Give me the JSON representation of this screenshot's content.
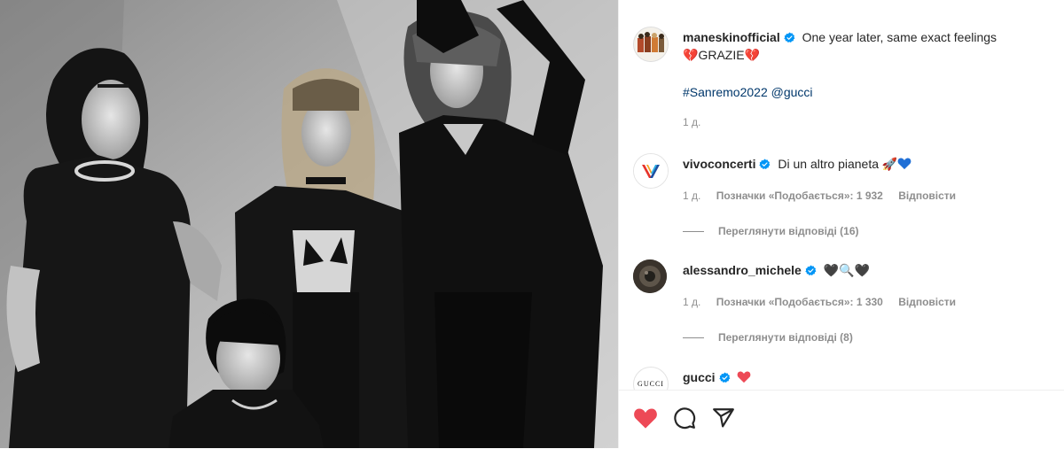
{
  "post": {
    "author": "maneskinofficial",
    "caption_line1": "One year later, same exact feelings",
    "caption_line2_word": "GRAZIE",
    "caption_line2_emoji_left": "💔",
    "caption_line2_emoji_right": "💔",
    "hashtag": "#Sanremo2022",
    "mention": "@gucci",
    "time": "1 д."
  },
  "comments": [
    {
      "username": "vivoconcerti",
      "text": "Di un altro pianeta",
      "emoji": "🚀",
      "time": "1 д.",
      "likes": "Позначки «Подобається»: 1 932",
      "reply_label": "Відповісти",
      "view_replies": "Переглянути відповіді (16)"
    },
    {
      "username": "alessandro_michele",
      "emoji": "🖤🔍🖤",
      "time": "1 д.",
      "likes": "Позначки «Подобається»: 1 330",
      "reply_label": "Відповісти",
      "view_replies": "Переглянути відповіді (8)"
    },
    {
      "username": "gucci",
      "logo_text": "GUCCI"
    }
  ],
  "colors": {
    "like_red": "#ed4956",
    "verified_blue": "#0095f6",
    "link_blue": "#00376b",
    "muted_gray": "#8e8e8e"
  },
  "icons": [
    "verified-badge-icon",
    "heart-icon",
    "comment-icon",
    "share-icon",
    "rocket-icon",
    "blue-heart-icon"
  ]
}
